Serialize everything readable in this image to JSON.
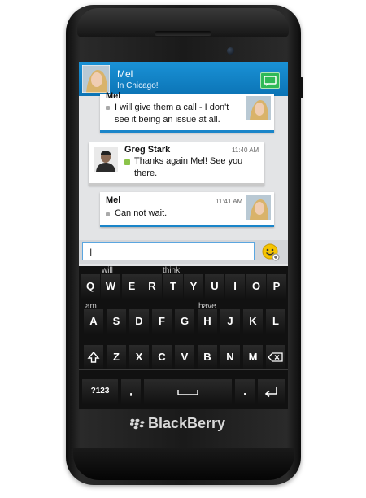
{
  "conversation": {
    "contact_name": "Mel",
    "contact_location": "In Chicago!"
  },
  "messages": [
    {
      "sender": "Mel",
      "line1": "I will give them a call - I don't",
      "line2": "see it being an issue at all.",
      "time": ""
    },
    {
      "sender": "Greg Stark",
      "line1": "Thanks again Mel!  See you",
      "line2": "there.",
      "time": "11:40 AM"
    },
    {
      "sender": "Mel",
      "line1": "Can not wait.",
      "line2": "",
      "time": "11:41 AM"
    }
  ],
  "composer": {
    "value": "I"
  },
  "keyboard": {
    "row1": [
      "Q",
      "W",
      "E",
      "R",
      "T",
      "Y",
      "U",
      "I",
      "O",
      "P"
    ],
    "row2": [
      "A",
      "S",
      "D",
      "F",
      "G",
      "H",
      "J",
      "K",
      "L"
    ],
    "row3": [
      "Z",
      "X",
      "C",
      "V",
      "B",
      "N",
      "M"
    ],
    "symbols_label": "?123",
    "comma_label": ",",
    "period_label": ".",
    "suggestions": [
      "will",
      "think",
      "am",
      "have"
    ]
  },
  "brand": {
    "text": "BlackBerry"
  },
  "colors": {
    "header_blue": "#0b73b5",
    "bubble_accent": "#1a85c9",
    "bbm_green": "#2fb957"
  },
  "icons": [
    "avatar-mel",
    "bbm-icon",
    "emoji-icon",
    "shift-icon",
    "backspace-icon",
    "space-icon",
    "enter-icon",
    "blackberry-logo"
  ]
}
